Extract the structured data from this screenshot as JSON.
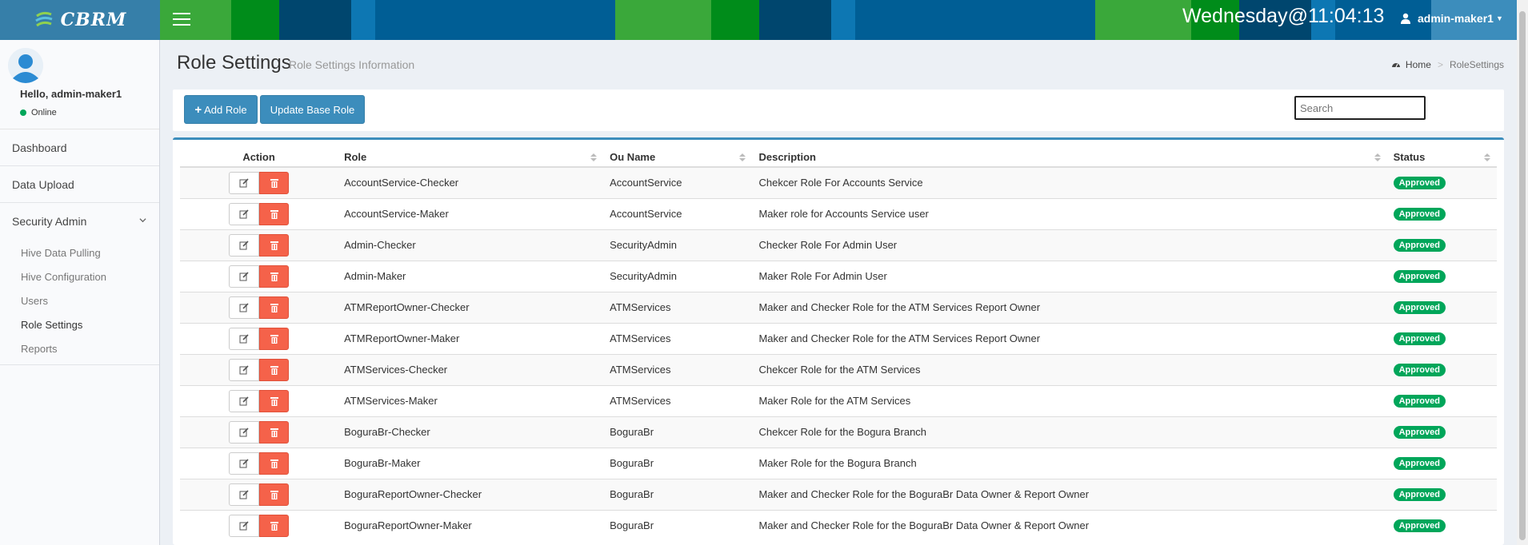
{
  "app": {
    "logo_text": "CBRM"
  },
  "header": {
    "clock": "Wednesday@11:04:13",
    "user": "admin-maker1",
    "stripe_colors": [
      "#3aa83a",
      "#008c1a",
      "#00466e",
      "#0d77b3",
      "#005e95",
      "#3aa83a",
      "#008c1a",
      "#00466e",
      "#0d77b3",
      "#005e95",
      "#3aa83a",
      "#008c1a",
      "#00466e",
      "#0d77b3",
      "#005e95"
    ]
  },
  "sidebar": {
    "greeting": "Hello, admin-maker1",
    "status": "Online",
    "items": [
      {
        "label": "Dashboard"
      },
      {
        "label": "Data Upload"
      },
      {
        "label": "Security Admin"
      }
    ],
    "subitems": [
      {
        "label": "Hive Data Pulling"
      },
      {
        "label": "Hive Configuration"
      },
      {
        "label": "Users"
      },
      {
        "label": "Role Settings"
      },
      {
        "label": "Reports"
      }
    ]
  },
  "page": {
    "title": "Role Settings",
    "subtitle": "Role Settings Information",
    "breadcrumb_home": "Home",
    "breadcrumb_current": "RoleSettings"
  },
  "toolbar": {
    "add_label": "Add Role",
    "update_label": "Update Base Role",
    "search_placeholder": "Search"
  },
  "table": {
    "columns": [
      "Action",
      "Role",
      "Ou Name",
      "Description",
      "Status"
    ],
    "rows": [
      {
        "role": "AccountService-Checker",
        "ou": "AccountService",
        "description": "Chekcer Role For Accounts Service",
        "status": "Approved"
      },
      {
        "role": "AccountService-Maker",
        "ou": "AccountService",
        "description": "Maker role for Accounts Service user",
        "status": "Approved"
      },
      {
        "role": "Admin-Checker",
        "ou": "SecurityAdmin",
        "description": "Checker Role For Admin User",
        "status": "Approved"
      },
      {
        "role": "Admin-Maker",
        "ou": "SecurityAdmin",
        "description": "Maker Role For Admin User",
        "status": "Approved"
      },
      {
        "role": "ATMReportOwner-Checker",
        "ou": "ATMServices",
        "description": "Maker and Checker Role for the ATM Services Report Owner",
        "status": "Approved"
      },
      {
        "role": "ATMReportOwner-Maker",
        "ou": "ATMServices",
        "description": "Maker and Checker Role for the ATM Services Report Owner",
        "status": "Approved"
      },
      {
        "role": "ATMServices-Checker",
        "ou": "ATMServices",
        "description": "Chekcer Role for the ATM Services",
        "status": "Approved"
      },
      {
        "role": "ATMServices-Maker",
        "ou": "ATMServices",
        "description": "Maker Role for the ATM Services",
        "status": "Approved"
      },
      {
        "role": "BoguraBr-Checker",
        "ou": "BoguraBr",
        "description": "Chekcer Role for the Bogura Branch",
        "status": "Approved"
      },
      {
        "role": "BoguraBr-Maker",
        "ou": "BoguraBr",
        "description": "Maker Role for the Bogura Branch",
        "status": "Approved"
      },
      {
        "role": "BoguraReportOwner-Checker",
        "ou": "BoguraBr",
        "description": "Maker and Checker Role for the BoguraBr Data Owner & Report Owner",
        "status": "Approved"
      },
      {
        "role": "BoguraReportOwner-Maker",
        "ou": "BoguraBr",
        "description": "Maker and Checker Role for the BoguraBr Data Owner & Report Owner",
        "status": "Approved"
      }
    ]
  },
  "icons": {
    "toggle": "hamburger-icon",
    "user": "user-icon",
    "home": "dashboard-icon",
    "edit": "edit-icon",
    "delete": "trash-icon",
    "sort": "sort-icon",
    "add": "plus-icon"
  },
  "colors": {
    "primary": "#3c8dbc",
    "danger": "#f5624a",
    "success": "#00a65a"
  }
}
